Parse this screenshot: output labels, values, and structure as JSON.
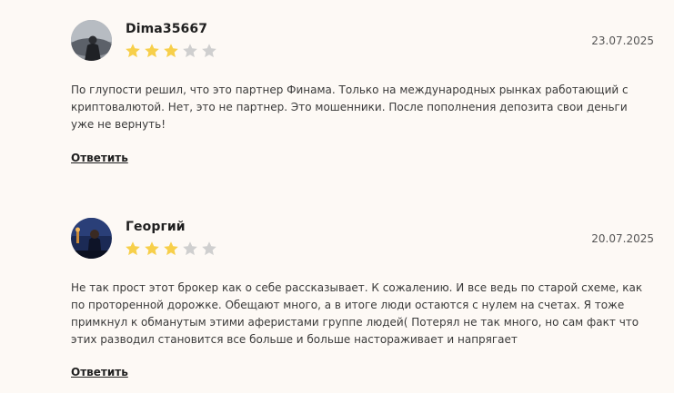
{
  "reviews": [
    {
      "author": "Dima35667",
      "rating": 3,
      "max_rating": 5,
      "date": "23.07.2025",
      "text": "По глупости решил, что это партнер Финама. Только на международных рынках работающий с криптовалютой. Нет, это не партнер. Это мошенники. После пополнения депозита свои деньги уже не вернуть!",
      "reply_label": "Ответить"
    },
    {
      "author": "Георгий",
      "rating": 3,
      "max_rating": 5,
      "date": "20.07.2025",
      "text": "Не так прост этот брокер как о себе рассказывает. К сожалению. И все ведь по старой схеме, как по проторенной дорожке. Обещают много, а в итоге люди остаются с нулем на счетах. Я тоже примкнул к обманутым этими аферистами группе людей( Потерял не так много, но сам факт что этих разводил становится все больше и больше настораживает и напрягает",
      "reply_label": "Ответить"
    }
  ],
  "colors": {
    "background": "#fdf9f5",
    "star_filled": "#f7cf4a",
    "star_empty": "#cfcfcf"
  }
}
